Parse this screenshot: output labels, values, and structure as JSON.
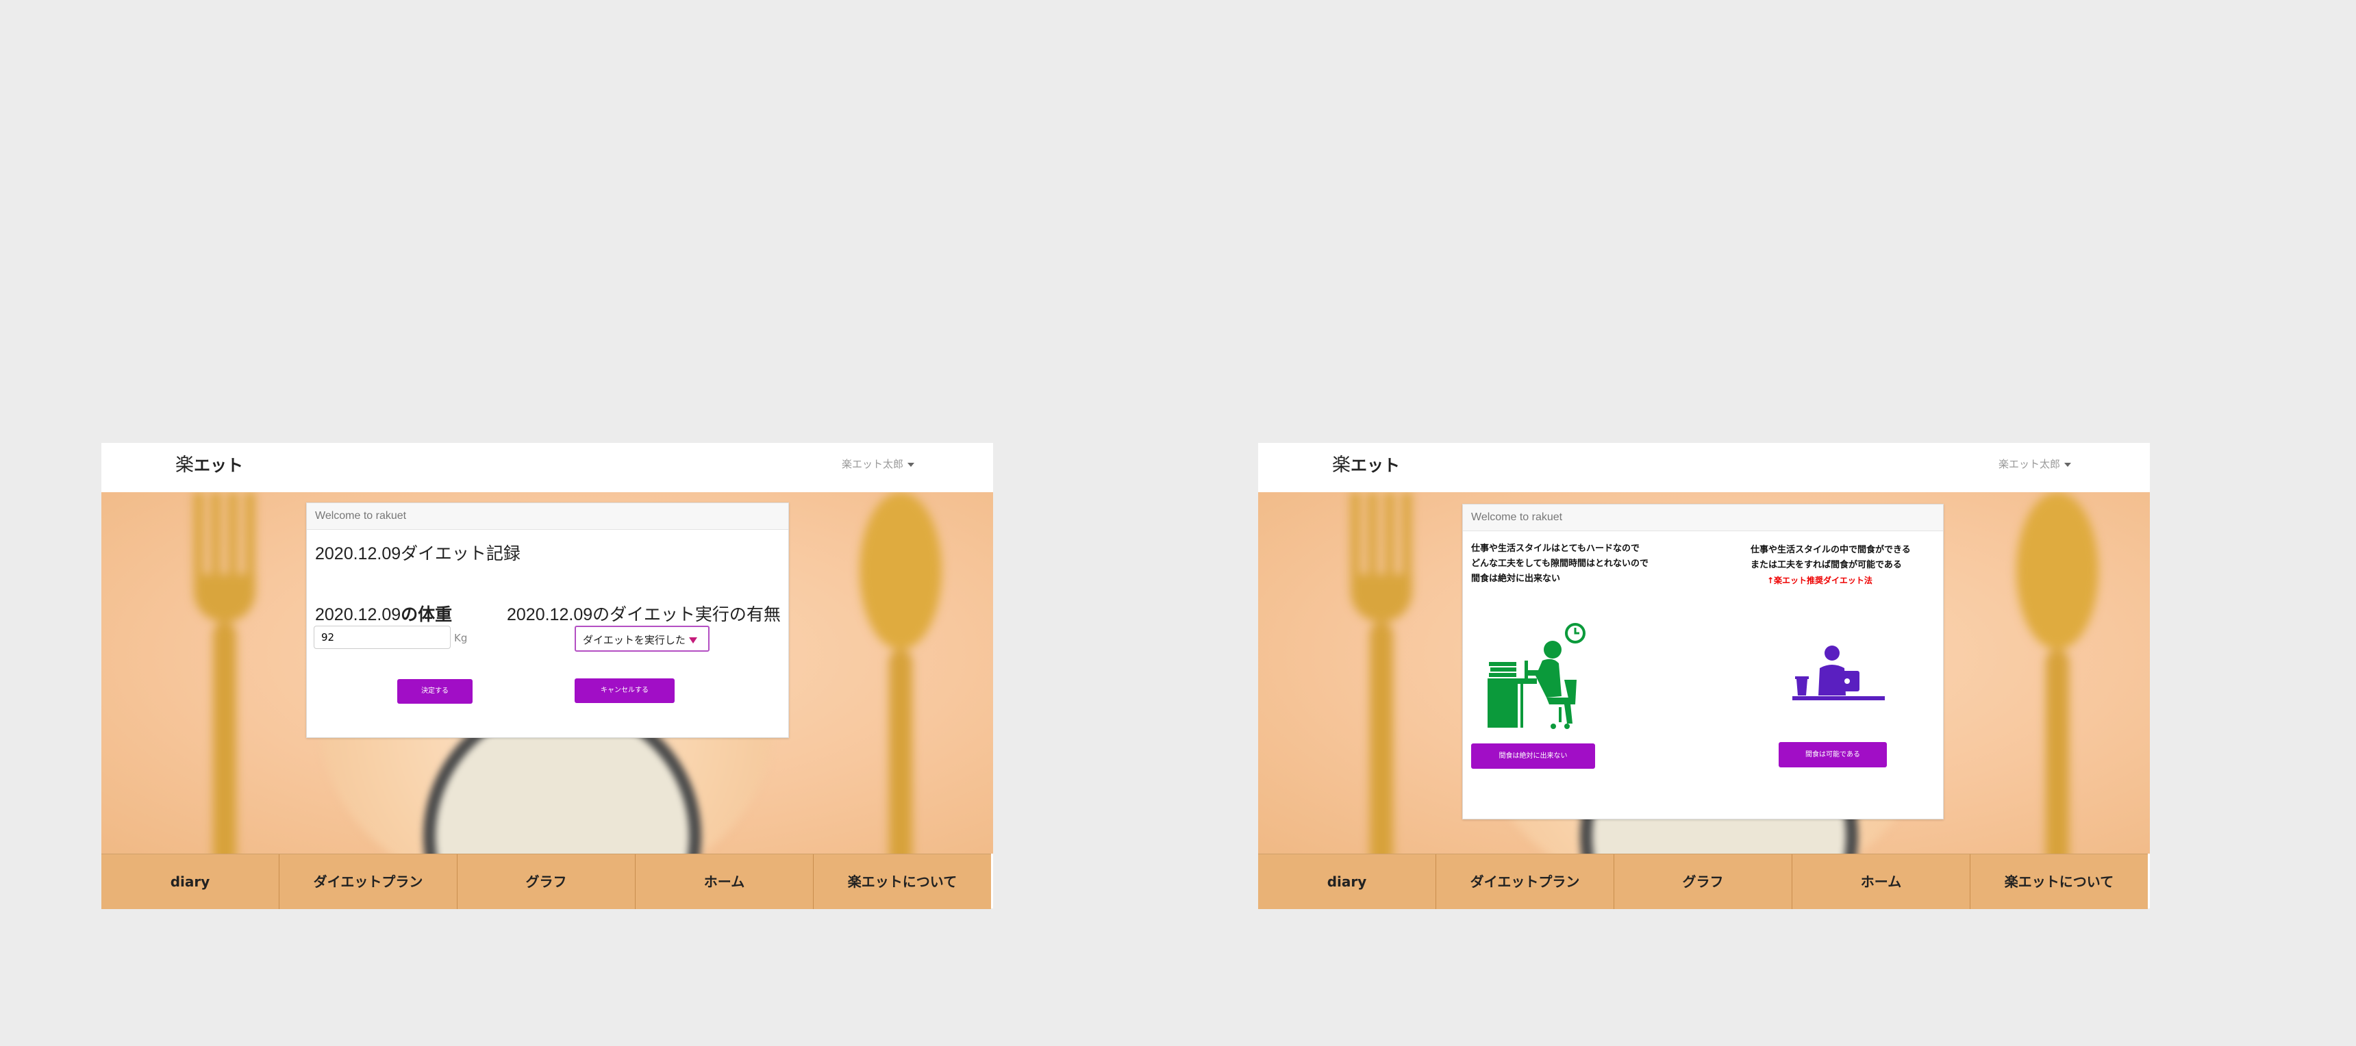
{
  "brand": {
    "kanji": "楽",
    "kata": "エット"
  },
  "user_menu": {
    "label": "楽エット太郎"
  },
  "card_header": "Welcome to rakuet",
  "left": {
    "record_title_date": "2020.12.09",
    "record_title_text": "ダイエット記録",
    "weight_label_date": "2020.12.09",
    "weight_label_text": "の体重",
    "weight_value": "92",
    "weight_unit": "Kg",
    "diet_label_date": "2020.12.09",
    "diet_label_text": "のダイエット実行の有無",
    "diet_select_value": "ダイエットを実行した",
    "confirm_button": "決定する",
    "cancel_button": "キャンセルする"
  },
  "right": {
    "option_a": {
      "lines": [
        "仕事や生活スタイルはとてもハードなので",
        "どんな工夫をしても隙間時間はとれないので",
        "間食は絶対に出来ない"
      ],
      "button": "間食は絶対に出来ない",
      "illustration_color": "#0b9a3b"
    },
    "option_b": {
      "lines": [
        "仕事や生活スタイルの中で間食ができる",
        "または工夫をすれば間食が可能である"
      ],
      "note": "↑楽エット推奨ダイエット法",
      "button": "間食は可能である",
      "illustration_color": "#5a1fc0"
    }
  },
  "footer_nav": [
    "diary",
    "ダイエットプラン",
    "グラフ",
    "ホーム",
    "楽エットについて"
  ],
  "colors": {
    "accent": "#a10ec6",
    "footer_bg": "#e9b276",
    "page_bg": "#ececec",
    "note_red": "#ee0000"
  }
}
